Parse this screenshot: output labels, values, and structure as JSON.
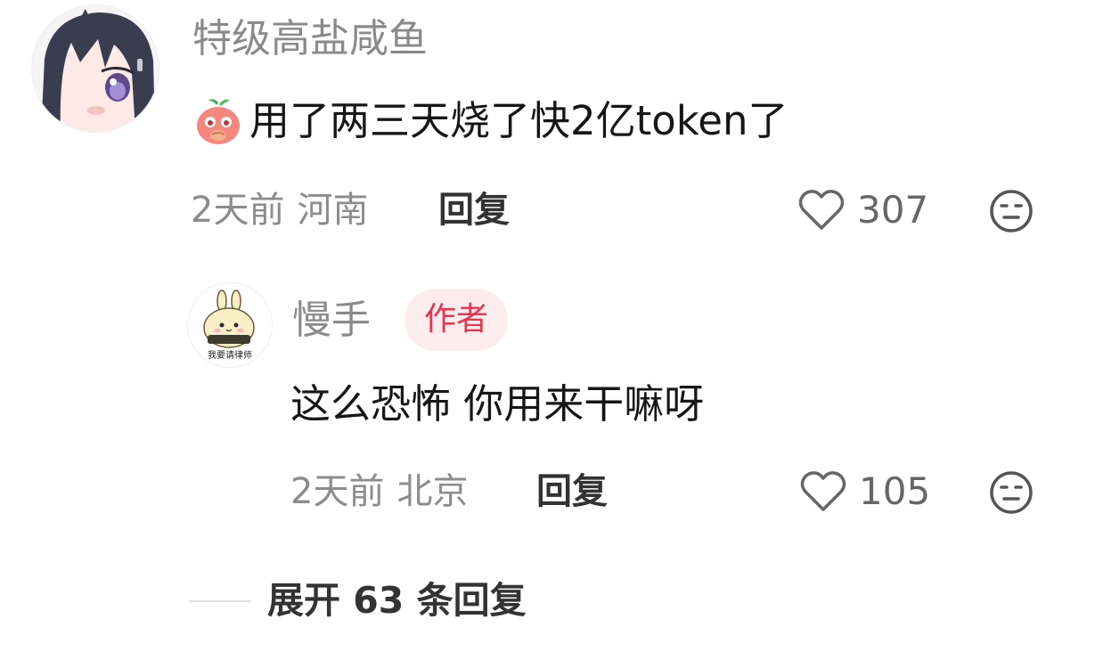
{
  "comment": {
    "username": "特级高盐咸鱼",
    "emoji_icon": "peach-cover-mouth-emoji-icon",
    "text": "用了两三天烧了快2亿token了",
    "time": "2天前",
    "location": "河南",
    "reply_label": "回复",
    "likes": "307",
    "like_icon": "heart-outline-icon",
    "neutral_icon": "neutral-face-icon"
  },
  "reply": {
    "username": "慢手",
    "author_badge": "作者",
    "text": "这么恐怖 你用来干嘛呀",
    "time": "2天前",
    "location": "北京",
    "reply_label": "回复",
    "likes": "105",
    "avatar_caption": "我要请律师"
  },
  "expand": {
    "label": "展开 63 条回复"
  },
  "colors": {
    "badge_text": "#e8344e",
    "badge_bg": "#fdecee",
    "meta_text": "#8c8c8c",
    "body_text": "#161616"
  }
}
